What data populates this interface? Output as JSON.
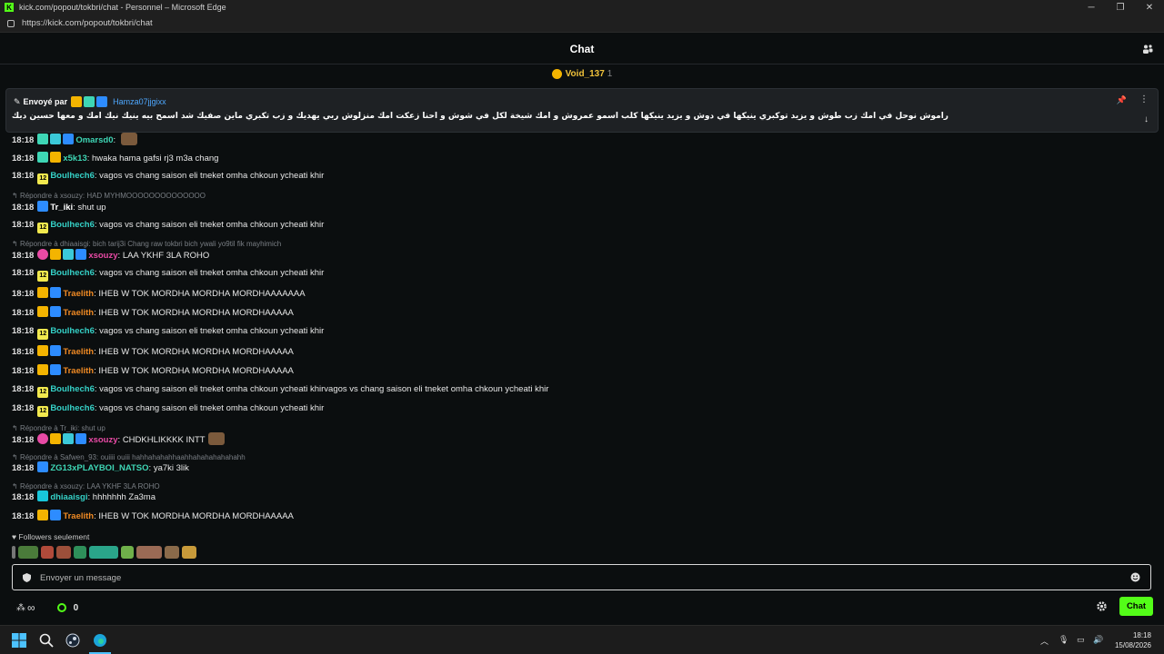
{
  "browser": {
    "title": "kick.com/popout/tokbri/chat - Personnel – Microsoft Edge",
    "url": "https://kick.com/popout/tokbri/chat"
  },
  "chat": {
    "title": "Chat",
    "top_user": {
      "name": "Void_137",
      "count": "1"
    }
  },
  "pinned": {
    "label": "Envoyé par",
    "user": "Hamza07jjgixx",
    "message": "راموش نوحل في أمك زب طوش و يزيد توكبري ينيكها في دوش و يزيد ينيكها كلب أسمو عمروش و أمك شيخة لكل في شوش و أحنا زعكت أمك منزلوش ربي يهديك و زب تكبري ماين صفيك شد أسمح بيه ينيك نيك أمك و معها حسين ديك و نيك أختك مغير متقولي شبيك و ترا أمك لقحبة كرت عليك بش تحت قسم أمك مولمك"
  },
  "messages": [
    {
      "type": "msg",
      "time": "18:18",
      "user": "Omarsd0",
      "text": "",
      "color": "#3ed6b5"
    },
    {
      "type": "msg",
      "time": "18:18",
      "user": "x5k13",
      "text": "hwaka hama gafsi rj3 m3a chang",
      "color": "#3ed6b5"
    },
    {
      "type": "msg",
      "time": "18:18",
      "user": "Boulhech6",
      "text": "vagos vs chang saison eli tneket omha chkoun ycheati khir",
      "color": "#35d1c7"
    },
    {
      "type": "reply",
      "text": "Répondre à xsouzy: HAD MYHMOOOOOOOOOOOOOO"
    },
    {
      "type": "msg",
      "time": "18:18",
      "user": "Tr_iki",
      "text": "shut up",
      "color": "#ffffff"
    },
    {
      "type": "msg",
      "time": "18:18",
      "user": "Boulhech6",
      "text": "vagos vs chang saison eli tneket omha chkoun ycheati khir",
      "color": "#35d1c7"
    },
    {
      "type": "reply",
      "text": "Répondre à dhiaaisgi: bich tarij3i Chang raw tokbri bich ywali yo9til fik mayhimich"
    },
    {
      "type": "msg",
      "time": "18:18",
      "user": "xsouzy",
      "text": "LAA YKHF 3LA ROHO",
      "color": "#e84aa5"
    },
    {
      "type": "msg",
      "time": "18:18",
      "user": "Boulhech6",
      "text": "vagos vs chang saison eli tneket omha chkoun ycheati khir",
      "color": "#35d1c7"
    },
    {
      "type": "msg",
      "time": "18:18",
      "user": "Traelith",
      "text": "IHEB W TOK MORDHA MORDHA MORDHAAAAAAA",
      "color": "#f08a24"
    },
    {
      "type": "msg",
      "time": "18:18",
      "user": "Traelith",
      "text": "IHEB W TOK MORDHA MORDHA MORDHAAAAA",
      "color": "#f08a24"
    },
    {
      "type": "msg",
      "time": "18:18",
      "user": "Boulhech6",
      "text": "vagos vs chang saison eli tneket omha chkoun ycheati khir",
      "color": "#35d1c7"
    },
    {
      "type": "msg",
      "time": "18:18",
      "user": "Traelith",
      "text": "IHEB W TOK MORDHA MORDHA MORDHAAAAA",
      "color": "#f08a24"
    },
    {
      "type": "msg",
      "time": "18:18",
      "user": "Traelith",
      "text": "IHEB W TOK MORDHA MORDHA MORDHAAAAA",
      "color": "#f08a24"
    },
    {
      "type": "msg",
      "time": "18:18",
      "user": "Boulhech6",
      "text": "vagos vs chang saison eli tneket omha chkoun ycheati khirvagos vs chang saison eli tneket omha chkoun ycheati khir",
      "color": "#35d1c7"
    },
    {
      "type": "msg",
      "time": "18:18",
      "user": "Boulhech6",
      "text": "vagos vs chang saison eli tneket omha chkoun ycheati khir",
      "color": "#35d1c7"
    },
    {
      "type": "reply",
      "text": "Répondre à Tr_iki: shut up"
    },
    {
      "type": "msg",
      "time": "18:18",
      "user": "xsouzy",
      "text": "CHDKHLIKKKK INTT",
      "color": "#e84aa5"
    },
    {
      "type": "reply",
      "text": "Répondre à Safwen_93: ouiiii ouiii hahhahahahhaahhahahahahahahh"
    },
    {
      "type": "msg",
      "time": "18:18",
      "user": "ZG13xPLAYBOI_NATSO",
      "text": "ya7ki 3lik",
      "color": "#3ed6b5"
    },
    {
      "type": "reply",
      "text": "Répondre à xsouzy: LAA YKHF 3LA ROHO"
    },
    {
      "type": "msg",
      "time": "18:18",
      "user": "dhiaaisgi",
      "text": "hhhhhhh Za3ma",
      "color": "#35d1c7"
    },
    {
      "type": "msg",
      "time": "18:18",
      "user": "Traelith",
      "text": "IHEB W TOK MORDHA MORDHA MORDHAAAAA",
      "color": "#f08a24"
    }
  ],
  "followers_only": "Followers seulement",
  "input": {
    "placeholder": "Envoyer un message"
  },
  "bottom": {
    "infinity": "∞",
    "points": "0",
    "chat_button": "Chat"
  },
  "taskbar": {
    "time": "18:18",
    "date": "15/08/2026"
  },
  "colors": {
    "accent": "#53fc18",
    "bg": "#0b0e0f"
  }
}
